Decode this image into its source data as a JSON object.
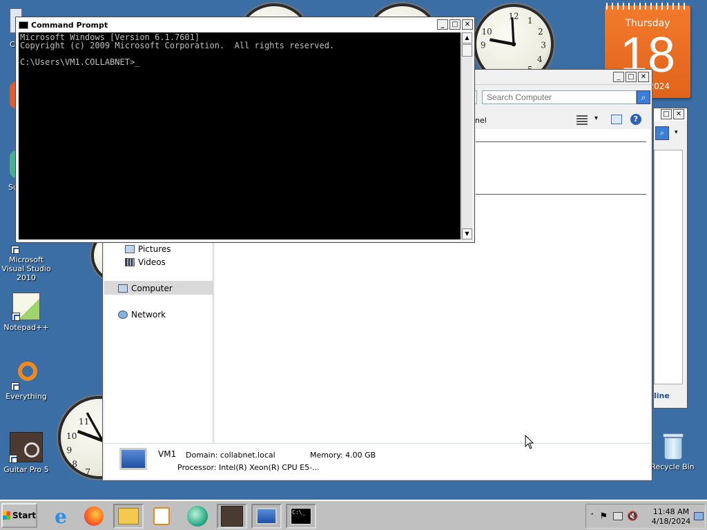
{
  "desktop": {
    "icons": [
      {
        "label": "Microsoft Visual Studio 2010"
      },
      {
        "label": "Notepad++"
      },
      {
        "label": "Everything"
      },
      {
        "label": "Guitar Pro 5"
      },
      {
        "label": "Recycle Bin"
      }
    ],
    "partial_icon_labels": [
      "C",
      "Su"
    ]
  },
  "calendar": {
    "weekday": "Thursday",
    "day": "18",
    "year_partial": "2024"
  },
  "cmd": {
    "title": "Command Prompt",
    "lines": [
      "Microsoft Windows [Version 6.1.7601]",
      "Copyright (c) 2009 Microsoft Corporation.  All rights reserved.",
      "",
      "C:\\Users\\VM1.COLLABNET>"
    ]
  },
  "explorer": {
    "search_placeholder": "Search Computer",
    "breadcrumb_partial": "nel",
    "nav": [
      {
        "label": "Pictures"
      },
      {
        "label": "Videos"
      },
      {
        "label": "Computer"
      },
      {
        "label": "Network"
      }
    ],
    "details": {
      "name": "VM1",
      "domain": "Domain: collabnet.local",
      "memory": "Memory: 4.00 GB",
      "processor": "Processor: Intel(R) Xeon(R) CPU E5-..."
    },
    "behind_window_text": "line"
  },
  "taskbar": {
    "start_label": "Start",
    "time": "11:48 AM",
    "date": "4/18/2024"
  }
}
